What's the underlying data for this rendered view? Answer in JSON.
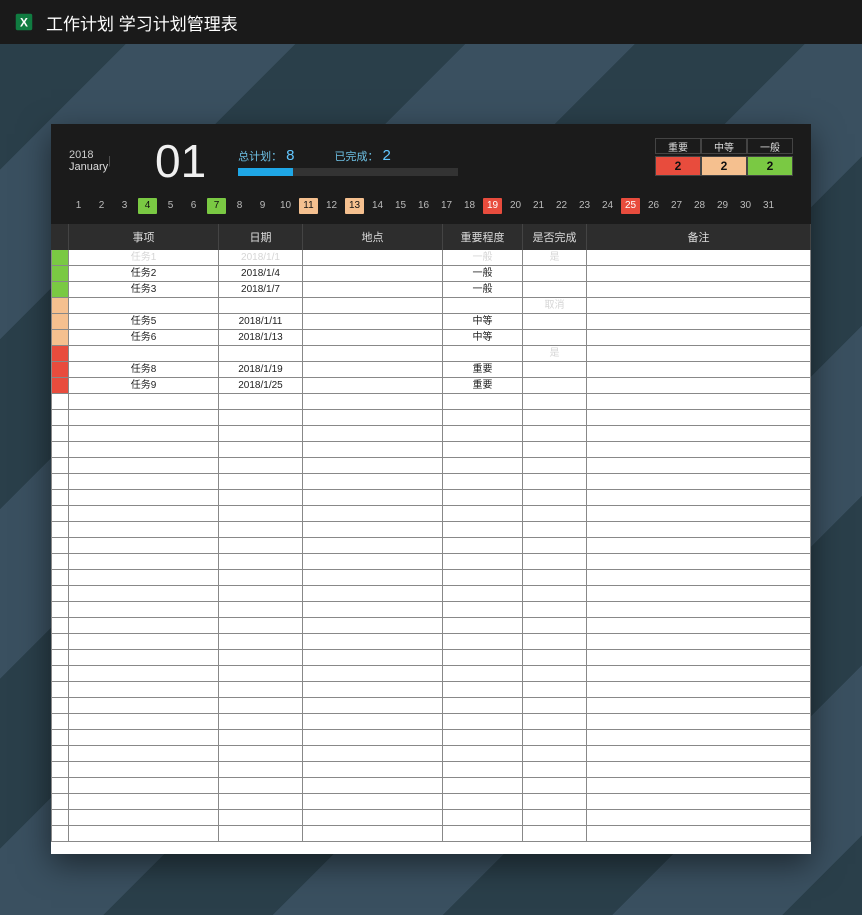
{
  "titlebar": {
    "title": "工作计划 学习计划管理表"
  },
  "header": {
    "year": "2018",
    "monthName": "January",
    "monthNum": "01",
    "labelTotal": "总计划：",
    "valTotal": "8",
    "labelDone": "已完成：",
    "valDone": "2",
    "progressPct": 25,
    "legend": {
      "important": "重要",
      "medium": "中等",
      "general": "一般",
      "countImportant": "2",
      "countMedium": "2",
      "countGeneral": "2"
    }
  },
  "calendar": {
    "days": [
      {
        "n": "1"
      },
      {
        "n": "2"
      },
      {
        "n": "3"
      },
      {
        "n": "4",
        "cls": "green"
      },
      {
        "n": "5"
      },
      {
        "n": "6"
      },
      {
        "n": "7",
        "cls": "green"
      },
      {
        "n": "8"
      },
      {
        "n": "9"
      },
      {
        "n": "10"
      },
      {
        "n": "11",
        "cls": "peach"
      },
      {
        "n": "12"
      },
      {
        "n": "13",
        "cls": "peach"
      },
      {
        "n": "14"
      },
      {
        "n": "15"
      },
      {
        "n": "16"
      },
      {
        "n": "17"
      },
      {
        "n": "18"
      },
      {
        "n": "19",
        "cls": "red"
      },
      {
        "n": "20"
      },
      {
        "n": "21"
      },
      {
        "n": "22"
      },
      {
        "n": "23"
      },
      {
        "n": "24"
      },
      {
        "n": "25",
        "cls": "red"
      },
      {
        "n": "26"
      },
      {
        "n": "27"
      },
      {
        "n": "28"
      },
      {
        "n": "29"
      },
      {
        "n": "30"
      },
      {
        "n": "31"
      }
    ]
  },
  "columns": {
    "item": "事项",
    "date": "日期",
    "location": "地点",
    "level": "重要程度",
    "done": "是否完成",
    "note": "备注"
  },
  "rows": [
    {
      "mark": "mk-green",
      "faded": true,
      "item": "任务1",
      "date": "2018/1/1",
      "loc": "",
      "level": "一般",
      "done": "是",
      "note": ""
    },
    {
      "mark": "mk-green",
      "item": "任务2",
      "date": "2018/1/4",
      "loc": "",
      "level": "一般",
      "done": "",
      "note": ""
    },
    {
      "mark": "mk-green",
      "item": "任务3",
      "date": "2018/1/7",
      "loc": "",
      "level": "一般",
      "done": "",
      "note": ""
    },
    {
      "mark": "mk-peach",
      "faded": true,
      "item": "",
      "date": "",
      "loc": "",
      "level": "",
      "done": "取消",
      "note": ""
    },
    {
      "mark": "mk-peach",
      "item": "任务5",
      "date": "2018/1/11",
      "loc": "",
      "level": "中等",
      "done": "",
      "note": ""
    },
    {
      "mark": "mk-peach",
      "item": "任务6",
      "date": "2018/1/13",
      "loc": "",
      "level": "中等",
      "done": "",
      "note": ""
    },
    {
      "mark": "mk-red",
      "faded": true,
      "item": "",
      "date": "",
      "loc": "",
      "level": "",
      "done": "是",
      "note": ""
    },
    {
      "mark": "mk-red",
      "item": "任务8",
      "date": "2018/1/19",
      "loc": "",
      "level": "重要",
      "done": "",
      "note": ""
    },
    {
      "mark": "mk-red",
      "item": "任务9",
      "date": "2018/1/25",
      "loc": "",
      "level": "重要",
      "done": "",
      "note": ""
    }
  ],
  "emptyRowsCount": 28
}
